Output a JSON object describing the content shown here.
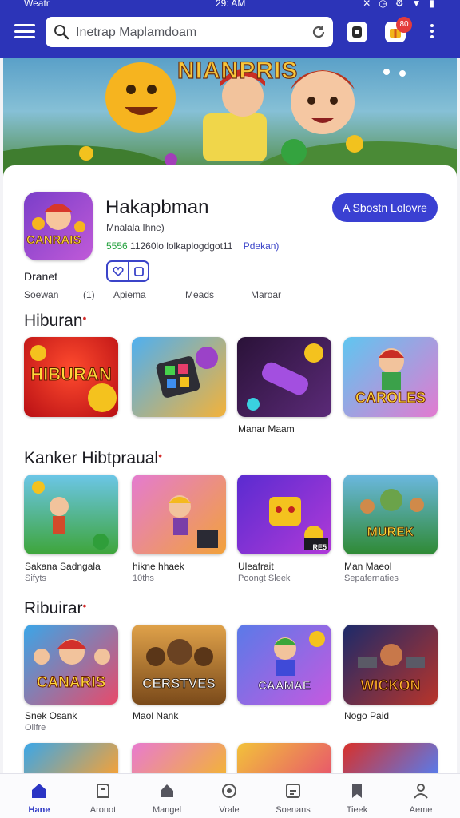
{
  "status_bar": {
    "carrier": "Weatr",
    "time": "29: AM",
    "icons": [
      "x-icon",
      "clock-icon",
      "settings-icon",
      "wifi-icon",
      "battery-icon"
    ]
  },
  "header": {
    "search_placeholder": "Inetrap Maplamdoam",
    "notification_badge": "80"
  },
  "banner": {
    "title": "NIANPRIS"
  },
  "app": {
    "icon_label": "CANRAIS",
    "title": "Hakapbman",
    "subtitle": "Mnalala Ihne)",
    "rating": "5556",
    "meta_text": "11260lo lolkaplogdgot11",
    "meta_link": "Pdekan)",
    "install_label": "A Sbostn Lolovre",
    "developer": "Dranet",
    "stats": {
      "reviews": "Soewan",
      "age": "(1)",
      "category": "Apiema",
      "downloads": "Meads",
      "more": "Maroar"
    }
  },
  "sections": [
    {
      "title": "Hiburan",
      "items": [
        {
          "art": "HIBURAN",
          "caption": "",
          "sub": ""
        },
        {
          "art": "",
          "caption": "",
          "sub": ""
        },
        {
          "art": "",
          "caption": "Manar Maam",
          "sub": ""
        },
        {
          "art": "CAROLES",
          "caption": "",
          "sub": ""
        }
      ]
    },
    {
      "title": "Kanker Hibtpraual",
      "items": [
        {
          "art": "",
          "caption": "Sakana Sadngala",
          "sub": "Sifyts"
        },
        {
          "art": "",
          "caption": "hikne hhaek",
          "sub": "10ths"
        },
        {
          "art": "RE5",
          "caption": "Uleafrait",
          "sub": "Poongt Sleek"
        },
        {
          "art": "MUREK",
          "caption": "Man Maeol",
          "sub": "Sepafernaties"
        }
      ]
    },
    {
      "title": "Ribuirar",
      "items": [
        {
          "art": "CANARIS",
          "caption": "Snek Osank",
          "sub": "Olifre"
        },
        {
          "art": "CERSTVES",
          "caption": "Maol Nank",
          "sub": ""
        },
        {
          "art": "CAAMAE",
          "caption": "",
          "sub": ""
        },
        {
          "art": "WICKON",
          "caption": "Nogo Paid",
          "sub": ""
        }
      ]
    }
  ],
  "bottom_nav": [
    {
      "label": "Hane",
      "icon": "home-icon",
      "active": true
    },
    {
      "label": "Aronot",
      "icon": "book-icon",
      "active": false
    },
    {
      "label": "Mangel",
      "icon": "house-icon",
      "active": false
    },
    {
      "label": "Vrale",
      "icon": "circle-icon",
      "active": false
    },
    {
      "label": "Soenans",
      "icon": "card-icon",
      "active": false
    },
    {
      "label": "Tieek",
      "icon": "bookmark-icon",
      "active": false
    },
    {
      "label": "Aeme",
      "icon": "person-icon",
      "active": false
    }
  ],
  "colors": {
    "primary": "#2c34b8",
    "accent": "#3a40d2",
    "alert": "#d42b2b"
  }
}
